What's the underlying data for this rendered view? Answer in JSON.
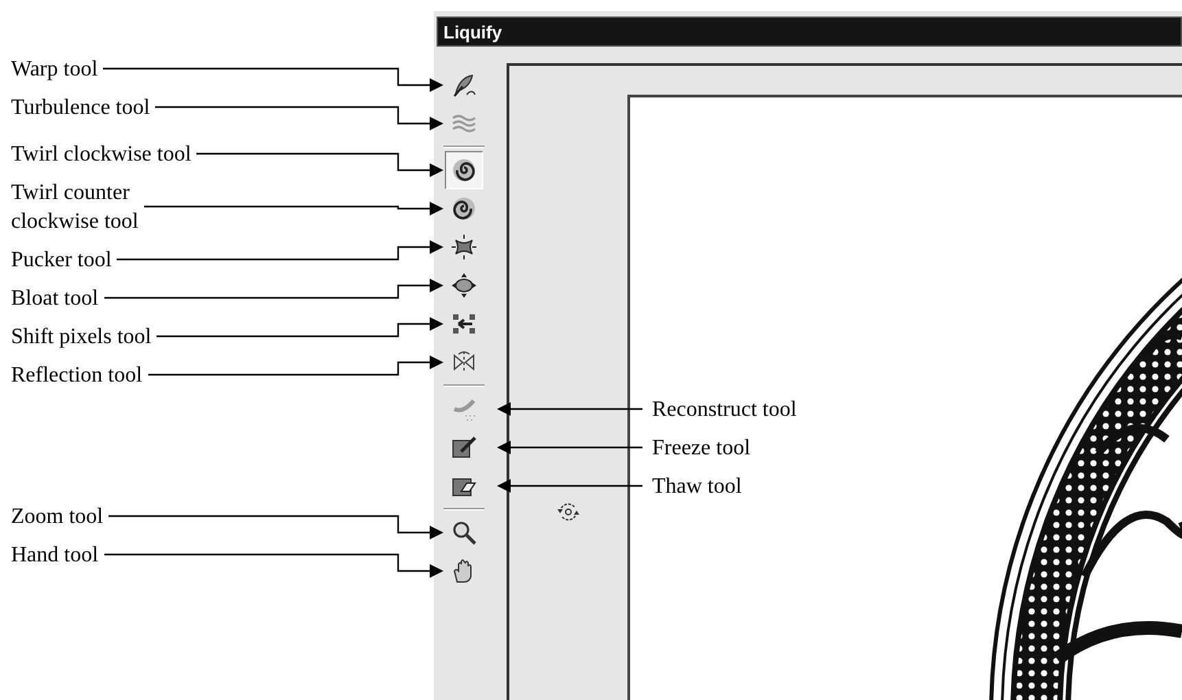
{
  "window": {
    "title": "Liquify"
  },
  "tool_groups": [
    [
      {
        "kind": "warp",
        "selected": false,
        "callout_left": "Warp tool"
      },
      {
        "kind": "turbulence",
        "selected": false,
        "callout_left": "Turbulence tool"
      }
    ],
    [
      {
        "kind": "twirl-cw",
        "selected": true,
        "callout_left": "Twirl clockwise tool"
      },
      {
        "kind": "twirl-ccw",
        "selected": false,
        "callout_left": "Twirl counter\nclockwise tool"
      },
      {
        "kind": "pucker",
        "selected": false,
        "callout_left": "Pucker tool"
      },
      {
        "kind": "bloat",
        "selected": false,
        "callout_left": "Bloat tool"
      },
      {
        "kind": "shift",
        "selected": false,
        "callout_left": "Shift pixels tool"
      },
      {
        "kind": "reflection",
        "selected": false,
        "callout_left": "Reflection tool"
      }
    ],
    [
      {
        "kind": "reconstruct",
        "selected": false,
        "callout_right": "Reconstruct tool"
      },
      {
        "kind": "freeze",
        "selected": false,
        "callout_right": "Freeze tool"
      },
      {
        "kind": "thaw",
        "selected": false,
        "callout_right": "Thaw tool"
      }
    ],
    [
      {
        "kind": "zoom",
        "selected": false,
        "callout_left": "Zoom tool"
      },
      {
        "kind": "hand",
        "selected": false,
        "callout_left": "Hand tool"
      }
    ]
  ]
}
